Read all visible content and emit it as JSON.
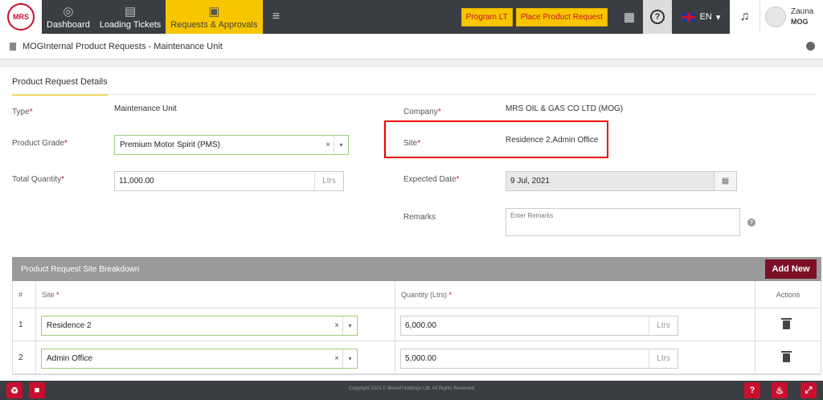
{
  "nav": {
    "logo_text": "MRS",
    "items": [
      {
        "label": "Dashboard",
        "icon": "dashboard-icon",
        "glyph": "◎"
      },
      {
        "label": "Loading Tickets",
        "icon": "ticket-icon",
        "glyph": "▤"
      },
      {
        "label": "Requests & Approvals",
        "icon": "approval-icon",
        "glyph": "▣"
      }
    ],
    "menu_glyph": "≡",
    "program_lt": "Program LT",
    "place_request": "Place Product Request",
    "grid_glyph": "▦",
    "help_glyph": "?",
    "language": "EN",
    "language_caret": "▾",
    "bell_glyph": "♫",
    "user_name": "Zauna",
    "user_org": "MOG"
  },
  "breadcrumb": {
    "title": "MOGInternal Product Requests - Maintenance Unit"
  },
  "tab": {
    "label": "Product Request Details"
  },
  "form": {
    "type_label": "Type",
    "type_value": "Maintenance Unit",
    "grade_label": "Product Grade",
    "grade_value": "Premium Motor Spirit (PMS)",
    "qty_label": "Total Quantity",
    "qty_value": "11,000.00",
    "qty_unit": "Ltrs",
    "company_label": "Company",
    "company_value": "MRS OIL & GAS CO LTD (MOG)",
    "site_label": "Site",
    "site_value": "Residence 2,Admin Office",
    "date_label": "Expected Date",
    "date_value": "9 Jul, 2021",
    "remarks_label": "Remarks",
    "remarks_placeholder": "Enter Remarks",
    "required": "*",
    "clear_glyph": "×",
    "caret_glyph": "▾",
    "calendar_glyph": "▦",
    "help_glyph": "?"
  },
  "breakdown": {
    "title": "Product Request Site Breakdown",
    "add_new": "Add New",
    "headers": {
      "num": "#",
      "site": "Site",
      "quantity": "Quantity (Ltrs)",
      "actions": "Actions"
    },
    "rows": [
      {
        "num": "1",
        "site": "Residence 2",
        "quantity": "6,000.00",
        "unit": "Ltrs"
      },
      {
        "num": "2",
        "site": "Admin Office",
        "quantity": "5,000.00",
        "unit": "Ltrs"
      }
    ]
  },
  "footer": {
    "copyright": "Copyright 2021 © Bestaf Holdings Ltd. All Rights Reserved",
    "left_glyphs": [
      "♻",
      "■"
    ],
    "right_glyphs": [
      "?",
      "♨",
      "⤢"
    ]
  }
}
